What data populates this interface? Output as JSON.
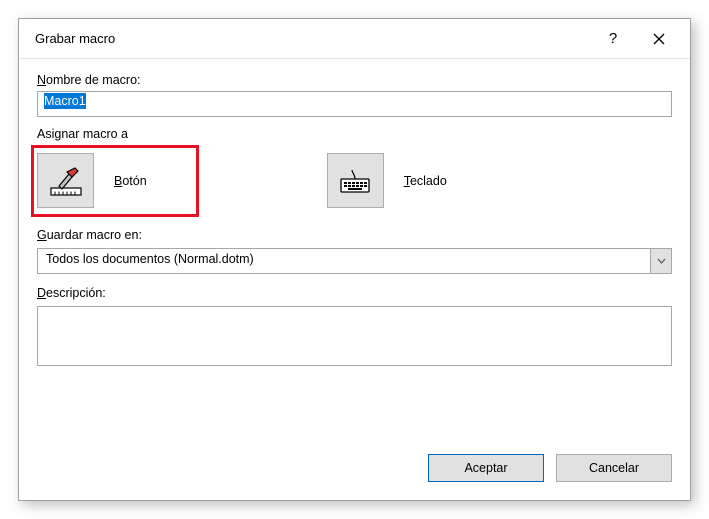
{
  "dialog": {
    "title": "Grabar macro",
    "help_label": "?",
    "close_label": "×"
  },
  "fields": {
    "name_label": "Nombre de macro:",
    "name_value": "Macro1",
    "assign_label": "Asignar macro a",
    "button_label": "Botón",
    "keyboard_label": "Teclado",
    "store_label": "Guardar macro en:",
    "store_value": "Todos los documentos (Normal.dotm)",
    "description_label": "Descripción:",
    "description_value": ""
  },
  "footer": {
    "ok": "Aceptar",
    "cancel": "Cancelar"
  }
}
